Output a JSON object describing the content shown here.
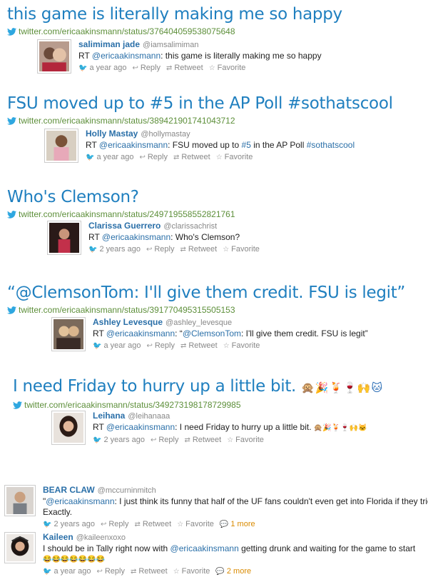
{
  "sections": [
    {
      "headline": "this game is literally making me so happy",
      "source": "twitter.com/ericaakinsmann/status/376404059538075648",
      "embed": {
        "name": "salimiman jade",
        "handle": "@iamsalimiman",
        "prefix": "RT ",
        "mention": "@ericaakinsmann",
        "text": ": this game is literally making me so happy",
        "time": "a year ago",
        "reply": "Reply",
        "retweet": "Retweet",
        "favorite": "Favorite"
      }
    },
    {
      "headline": "FSU moved up to #5 in the AP Poll #sothatscool",
      "source": "twitter.com/ericaakinsmann/status/389421901741043712",
      "embed": {
        "name": "Holly Mastay",
        "handle": "@hollymastay",
        "prefix": "RT ",
        "mention": "@ericaakinsmann",
        "text_a": ": FSU moved up to ",
        "hashtag_a": "#5",
        "text_b": " in the AP Poll ",
        "hashtag_b": "#sothatscool",
        "time": "a year ago",
        "reply": "Reply",
        "retweet": "Retweet",
        "favorite": "Favorite"
      }
    },
    {
      "headline": "Who's Clemson?",
      "source": "twitter.com/ericaakinsmann/status/249719558552821761",
      "embed": {
        "name": "Clarissa Guerrero",
        "handle": "@clarissachrist",
        "prefix": "RT ",
        "mention": "@ericaakinsmann",
        "text": ": Who's Clemson?",
        "time": "2 years ago",
        "reply": "Reply",
        "retweet": "Retweet",
        "favorite": "Favorite"
      }
    },
    {
      "headline": "“@ClemsonTom: I'll give them credit. FSU is legit”",
      "source": "twitter.com/ericaakinsmann/status/391770495315505153",
      "embed": {
        "name": "Ashley Levesque",
        "handle": "@ashley_levesque",
        "prefix": "RT ",
        "mention": "@ericaakinsmann",
        "text_a": ": “",
        "mention_b": "@ClemsonTom",
        "text_b": ": I'll give them credit. FSU is legit”",
        "time": "a year ago",
        "reply": "Reply",
        "retweet": "Retweet",
        "favorite": "Favorite"
      }
    },
    {
      "headline": "I need Friday to hurry up a little bit.",
      "emoji": "🙊🎉🍹🍷🙌🐱",
      "source": "twitter.com/ericaakinsmann/status/349273198178729985",
      "embed": {
        "name": "Leihana",
        "handle": "@leihanaaa",
        "prefix": "RT ",
        "mention": "@ericaakinsmann",
        "text": ": I need Friday to hurry up a little bit.",
        "emoji": "🙊🎉🍹🍷🙌🐱",
        "time": "2 years ago",
        "reply": "Reply",
        "retweet": "Retweet",
        "favorite": "Favorite"
      }
    }
  ],
  "replies": [
    {
      "name": "BEAR CLAW",
      "handle": "@mccurninmitch",
      "text_prefix": "\"",
      "mention": "@ericaakinsmann",
      "text": ": I just think its funny that half of the UF fans couldn't even get into Florida if they tried.\"",
      "text_line2": "Exactly.",
      "time": "2 years ago",
      "reply": "Reply",
      "retweet": "Retweet",
      "favorite": "Favorite",
      "more": "1 more"
    },
    {
      "name": "Kaileen",
      "handle": "@kaileenxoxo",
      "text_a": "I should be in Tally right now with ",
      "mention": "@ericaakinsmann",
      "text_b": " getting drunk and waiting for the game to start",
      "text_line2": "😂😂😂😂😂😂😂",
      "time": "a year ago",
      "reply": "Reply",
      "retweet": "Retweet",
      "favorite": "Favorite",
      "more": "2 more"
    }
  ],
  "colors": {
    "link": "#1f7fbf",
    "source": "#5d8f3a",
    "mention": "#2a6fa8",
    "more": "#d98a00"
  }
}
